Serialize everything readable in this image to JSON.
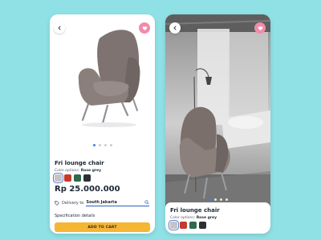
{
  "product": {
    "name": "Fri lounge chair",
    "color_label": "Color options:",
    "color_selected": "Rose grey",
    "price": "Rp 25.000.000",
    "swatches": [
      "#c8c2c4",
      "#c53a2c",
      "#2f6a4d",
      "#2d2f33"
    ]
  },
  "delivery": {
    "label": "Delivery to",
    "city": "South Jakarta"
  },
  "spec_label": "Specification details",
  "cart_label": "ADD TO CART",
  "icons": {
    "back": "chevron-left-icon",
    "favorite": "heart-icon",
    "delivery": "tag-icon",
    "search": "search-icon"
  },
  "colors": {
    "background": "#8fe1e6",
    "accent": "#f5b634",
    "heart": "#f08ca9",
    "link": "#2b5fbf"
  },
  "carousel": {
    "count": 4,
    "active": 1
  }
}
